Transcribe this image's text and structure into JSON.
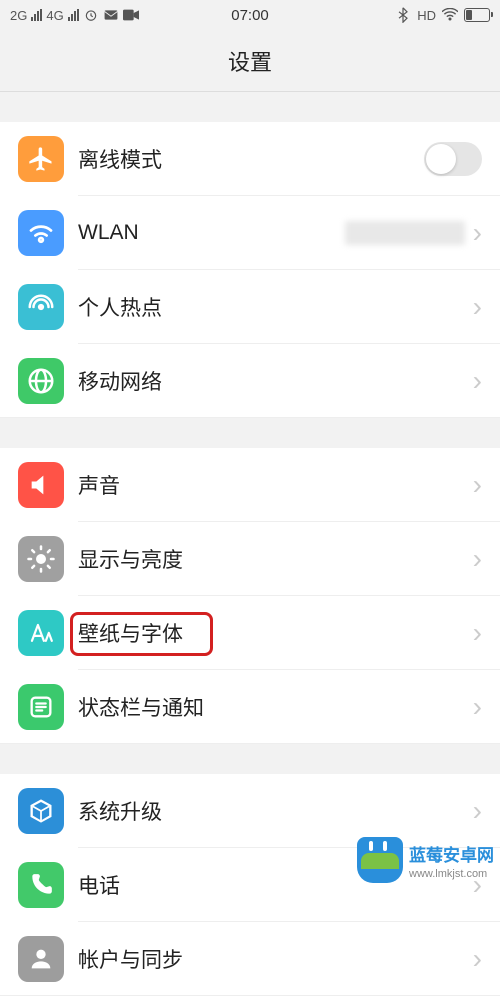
{
  "status": {
    "left_net1": "2G",
    "left_net2": "4G",
    "time": "07:00",
    "hd": "HD"
  },
  "header": {
    "title": "设置"
  },
  "group1": {
    "airplane": "离线模式",
    "wlan": "WLAN",
    "hotspot": "个人热点",
    "mobile": "移动网络"
  },
  "group2": {
    "sound": "声音",
    "display": "显示与亮度",
    "wallpaper": "壁纸与字体",
    "statusbar": "状态栏与通知"
  },
  "group3": {
    "update": "系统升级",
    "phone": "电话",
    "account": "帐户与同步"
  },
  "watermark": {
    "title": "蓝莓安卓网",
    "url": "www.lmkjst.com"
  }
}
